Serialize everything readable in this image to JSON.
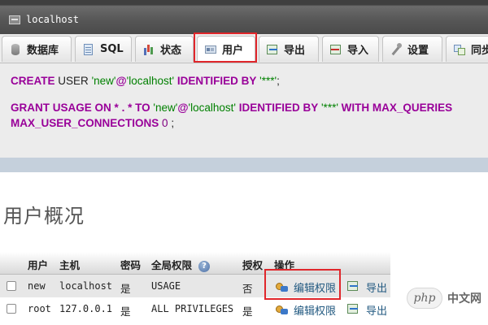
{
  "window": {
    "title": "localhost",
    "server_icon": "server-icon"
  },
  "tabs": [
    {
      "label": "数据库",
      "icon": "database-icon"
    },
    {
      "label": "SQL",
      "icon": "sql-icon"
    },
    {
      "label": "状态",
      "icon": "status-icon"
    },
    {
      "label": "用户",
      "icon": "user-icon",
      "active": true,
      "highlighted": true
    },
    {
      "label": "导出",
      "icon": "export-icon"
    },
    {
      "label": "导入",
      "icon": "import-icon"
    },
    {
      "label": "设置",
      "icon": "settings-icon"
    },
    {
      "label": "同步",
      "icon": "sync-icon"
    }
  ],
  "sql": {
    "line1": {
      "kw1": "CREATE",
      "plain1": "USER",
      "str1": "'new'",
      "at": "@",
      "str2": "'localhost'",
      "kw2": "IDENTIFIED BY",
      "str3": "'***'",
      "end": ";"
    },
    "line2": {
      "kw1": "GRANT USAGE ON",
      "star1": "*",
      "dot": ".",
      "star2": "*",
      "kw2": "TO",
      "str1": "'new'",
      "at": "@",
      "str2": "'localhost'",
      "kw3": "IDENTIFIED BY",
      "str3": "'***'",
      "kw4": "WITH MAX_QUERIES"
    },
    "line3": {
      "kw1": "MAX_USER_CONNECTIONS",
      "num": "0",
      "end": ";"
    }
  },
  "section": {
    "title": "用户概况"
  },
  "table": {
    "headers": {
      "user": "用户",
      "host": "主机",
      "password": "密码",
      "global_privileges": "全局权限",
      "help_glyph": "?",
      "grant": "授权",
      "action": "操作"
    },
    "rows": [
      {
        "user": "new",
        "host": "localhost",
        "password": "是",
        "privileges": "USAGE",
        "grant": "否",
        "edit": "编辑权限",
        "export": "导出",
        "edit_highlighted": true
      },
      {
        "user": "root",
        "host": "127.0.0.1",
        "password": "是",
        "privileges": "ALL PRIVILEGES",
        "grant": "是",
        "edit": "编辑权限",
        "export": "导出"
      }
    ]
  },
  "watermark": {
    "badge": "php",
    "text": "中文网"
  },
  "colors": {
    "keyword": "#990099",
    "string": "#008000",
    "highlight_box": "#e0262b",
    "link": "#235a81"
  }
}
